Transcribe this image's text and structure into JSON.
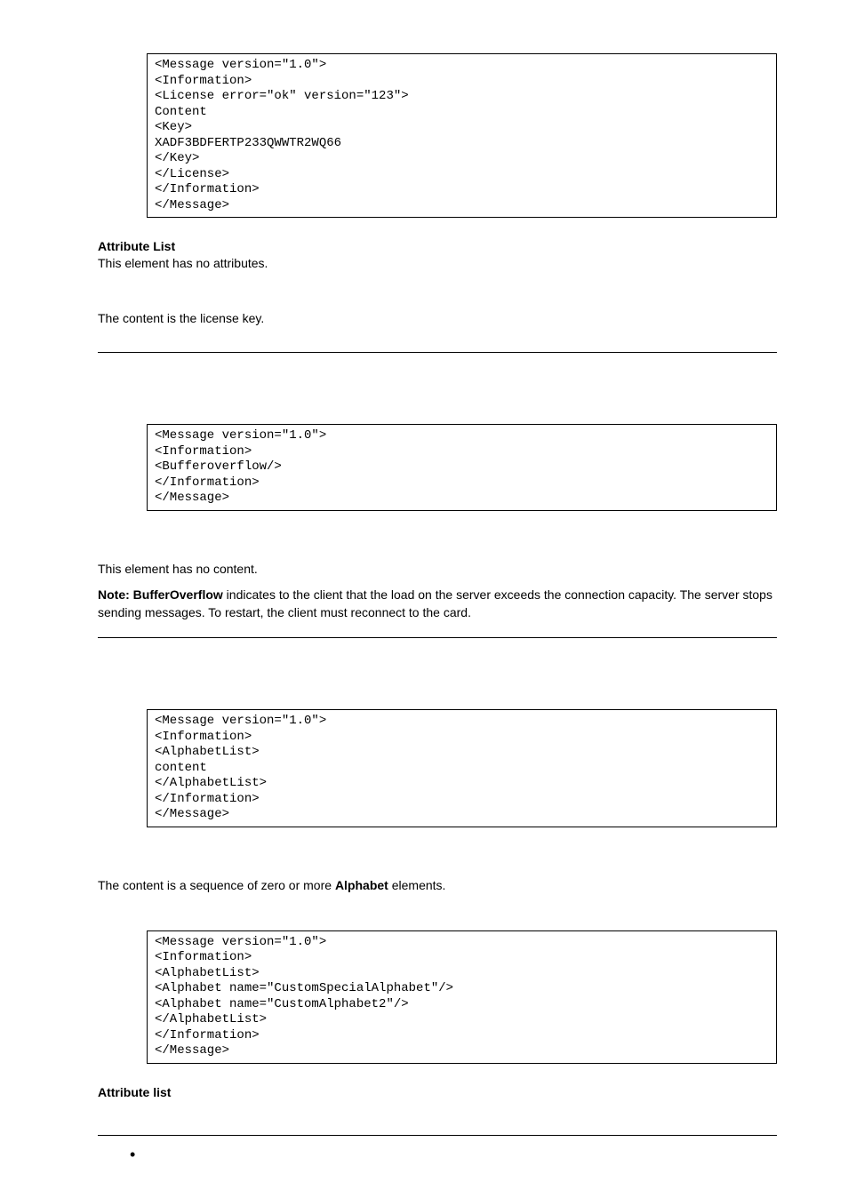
{
  "code1": "<Message version=\"1.0\">\n<Information>\n<License error=\"ok\" version=\"123\">\nContent\n<Key>\nXADF3BDFERTP233QWWTR2WQ66\n</Key>\n</License>\n</Information>\n</Message>",
  "h1": "Attribute List",
  "p1": "This element has no attributes.",
  "p2": "The content is the license key.",
  "code2": "<Message version=\"1.0\">\n<Information>\n<Bufferoverflow/>\n</Information>\n</Message>",
  "p3": "This element has no content.",
  "note_label": "Note: BufferOverflow",
  "note_rest": " indicates to the client that the load on the server exceeds the connection capacity. The server stops sending messages. To restart, the client must reconnect to the card.",
  "code3": "<Message version=\"1.0\">\n<Information>\n<AlphabetList>\ncontent\n</AlphabetList>\n</Information>\n</Message>",
  "p4_pre": "The content is a sequence of zero or more ",
  "p4_bold": "Alphabet",
  "p4_post": " elements.",
  "code4": "<Message version=\"1.0\">\n<Information>\n<AlphabetList>\n<Alphabet name=\"CustomSpecialAlphabet\"/>\n<Alphabet name=\"CustomAlphabet2\"/>\n</AlphabetList>\n</Information>\n</Message>",
  "h2": "Attribute list"
}
